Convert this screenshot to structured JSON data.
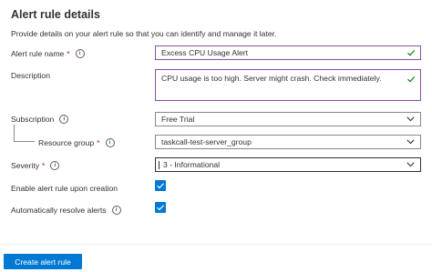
{
  "header": {
    "title": "Alert rule details",
    "subtitle": "Provide details on your alert rule so that you can identify and manage it later."
  },
  "form": {
    "alert_rule_name": {
      "label": "Alert rule name",
      "required_mark": "*",
      "value": "Excess CPU Usage Alert"
    },
    "description": {
      "label": "Description",
      "value": "CPU usage is too high. Server might crash. Check immediately."
    },
    "subscription": {
      "label": "Subscription",
      "value": "Free Trial"
    },
    "resource_group": {
      "label": "Resource group",
      "required_mark": "*",
      "value": "taskcall-test-server_group"
    },
    "severity": {
      "label": "Severity",
      "required_mark": "*",
      "value": "3 - Informational"
    },
    "enable_upon_creation": {
      "label": "Enable alert rule upon creation",
      "checked": true
    },
    "auto_resolve": {
      "label": "Automatically resolve alerts",
      "checked": true
    }
  },
  "footer": {
    "create_label": "Create alert rule"
  },
  "colors": {
    "accent": "#0078d4",
    "valid_border": "#8a4fa8",
    "check": "#107c10",
    "required": "#a4262c"
  },
  "icons": {
    "info": "info-icon",
    "valid": "checkmark-icon",
    "dropdown": "chevron-down-icon"
  }
}
